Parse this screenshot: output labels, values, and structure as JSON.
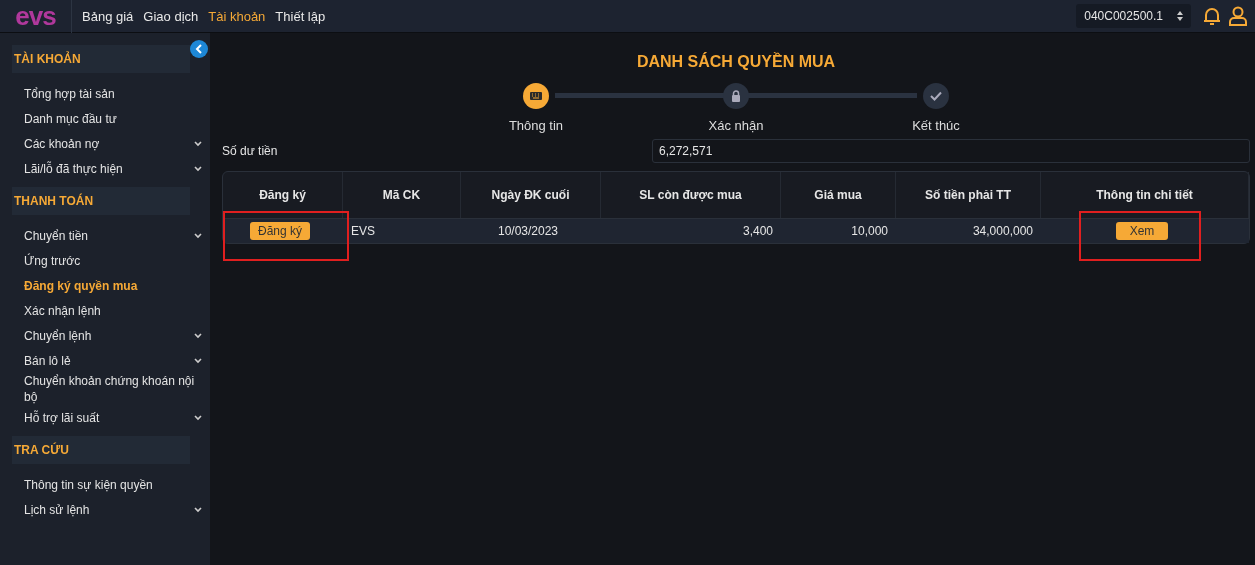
{
  "topbar": {
    "logo": "evs",
    "menu": [
      {
        "label": "Bảng giá",
        "selected": false
      },
      {
        "label": "Giao dịch",
        "selected": false
      },
      {
        "label": "Tài khoản",
        "selected": true
      },
      {
        "label": "Thiết lập",
        "selected": false
      }
    ],
    "account": "040C002500.1"
  },
  "sidebar": {
    "sections": [
      {
        "title": "TÀI KHOẢN",
        "items": [
          {
            "label": "Tổng hợp tài sản",
            "has_submenu": false,
            "selected": false
          },
          {
            "label": "Danh mục đầu tư",
            "has_submenu": false,
            "selected": false
          },
          {
            "label": "Các khoản nợ",
            "has_submenu": true,
            "selected": false
          },
          {
            "label": "Lãi/lỗ đã thực hiện",
            "has_submenu": true,
            "selected": false
          }
        ]
      },
      {
        "title": "THANH TOÁN",
        "items": [
          {
            "label": "Chuyển tiền",
            "has_submenu": true,
            "selected": false
          },
          {
            "label": "Ứng trước",
            "has_submenu": false,
            "selected": false
          },
          {
            "label": "Đăng ký quyền mua",
            "has_submenu": false,
            "selected": true
          },
          {
            "label": "Xác nhận lệnh",
            "has_submenu": false,
            "selected": false
          },
          {
            "label": "Chuyển lệnh",
            "has_submenu": true,
            "selected": false
          },
          {
            "label": "Bán lô lẻ",
            "has_submenu": true,
            "selected": false
          },
          {
            "label": "Chuyển khoản chứng khoán nội bộ",
            "has_submenu": false,
            "selected": false
          },
          {
            "label": "Hỗ trợ lãi suất",
            "has_submenu": true,
            "selected": false
          }
        ]
      },
      {
        "title": "TRA CỨU",
        "items": [
          {
            "label": "Thông tin sự kiện quyền",
            "has_submenu": false,
            "selected": false
          },
          {
            "label": "Lịch sử lệnh",
            "has_submenu": true,
            "selected": false
          }
        ]
      }
    ]
  },
  "page": {
    "title": "DANH SÁCH QUYỀN MUA",
    "steps": [
      {
        "label": "Thông tin",
        "kind": "keyboard",
        "selected": true
      },
      {
        "label": "Xác nhận",
        "kind": "lock",
        "selected": false
      },
      {
        "label": "Kết thúc",
        "kind": "check",
        "selected": false
      }
    ],
    "balance": {
      "label": "Số dư tiền",
      "value": "6,272,571"
    },
    "table": {
      "columns": [
        "Đăng ký",
        "Mã CK",
        "Ngày ĐK cuối",
        "SL còn được mua",
        "Giá mua",
        "Số tiền phải TT",
        "Thông tin chi tiết"
      ],
      "rows": [
        {
          "register": "Đăng ký",
          "symbol": "EVS",
          "last_date": "10/03/2023",
          "quantity": "3,400",
          "price": "10,000",
          "amount": "34,000,000",
          "detail": "Xem",
          "register_marked": true,
          "detail_marked": true
        }
      ]
    }
  }
}
